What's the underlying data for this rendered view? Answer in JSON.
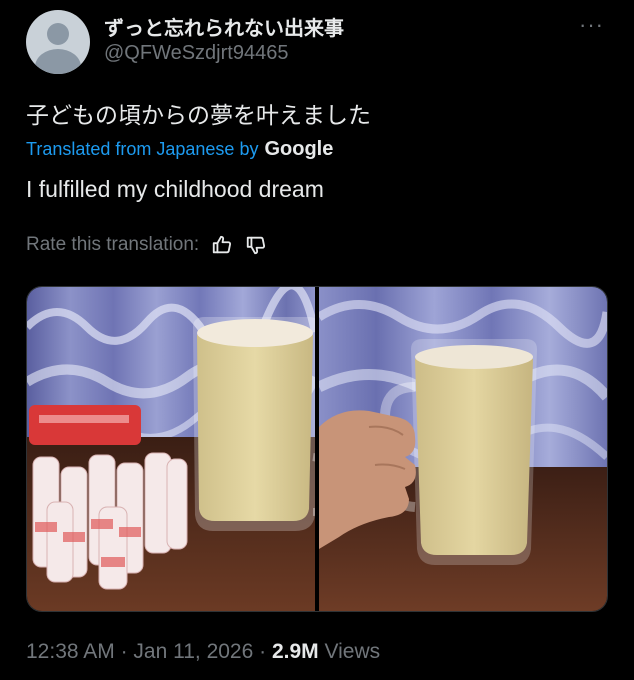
{
  "author": {
    "display_name": "ずっと忘れられない出来事",
    "handle": "@QFWeSzdjrt94465"
  },
  "more_label": "···",
  "tweet": {
    "original_text": "子どもの頃からの夢を叶えました",
    "translated_from": "Translated from Japanese by",
    "translator": "Google",
    "translated_text": "I fulfilled my childhood dream"
  },
  "rate": {
    "label": "Rate this translation:"
  },
  "photos": [
    {
      "alt": "photo-left"
    },
    {
      "alt": "photo-right"
    }
  ],
  "meta": {
    "time": "12:38 AM",
    "sep1": " · ",
    "date": "Jan 11, 2026",
    "sep2": " · ",
    "views_count": "2.9M",
    "views_label": " Views"
  },
  "colors": {
    "background": "#000000",
    "text": "#e7e9ea",
    "muted": "#71767b",
    "link": "#1d9bf0"
  }
}
